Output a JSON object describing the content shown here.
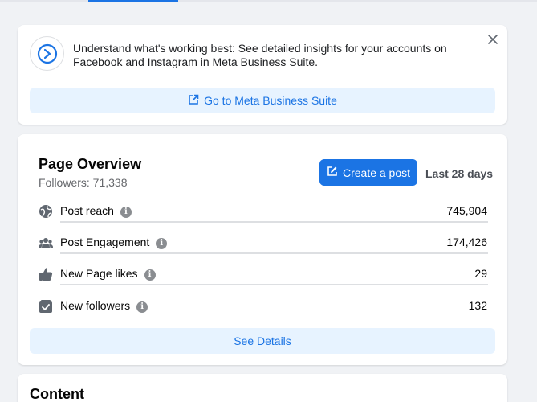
{
  "banner": {
    "text": "Understand what's working best: See detailed insights for your accounts on Facebook and Instagram in Meta Business Suite.",
    "button_label": "Go to Meta Business Suite",
    "close_icon": "close-icon",
    "logo_icon": "meta-business-suite-icon"
  },
  "overview": {
    "title": "Page Overview",
    "followers": "Followers: 71,338",
    "create_post_label": "Create a post",
    "range_label": "Last 28 days",
    "metrics": [
      {
        "label": "Post reach",
        "value": "745,904",
        "icon": "globe-icon"
      },
      {
        "label": "Post Engagement",
        "value": "174,426",
        "icon": "people-icon"
      },
      {
        "label": "New Page likes",
        "value": "29",
        "icon": "thumbs-up-icon"
      },
      {
        "label": "New followers",
        "value": "132",
        "icon": "follow-icon"
      }
    ],
    "see_details_label": "See Details"
  },
  "content": {
    "title": "Content"
  },
  "colors": {
    "accent": "#1b74e4",
    "button_light_bg": "#e7f3ff",
    "page_bg": "#f0f2f5"
  }
}
